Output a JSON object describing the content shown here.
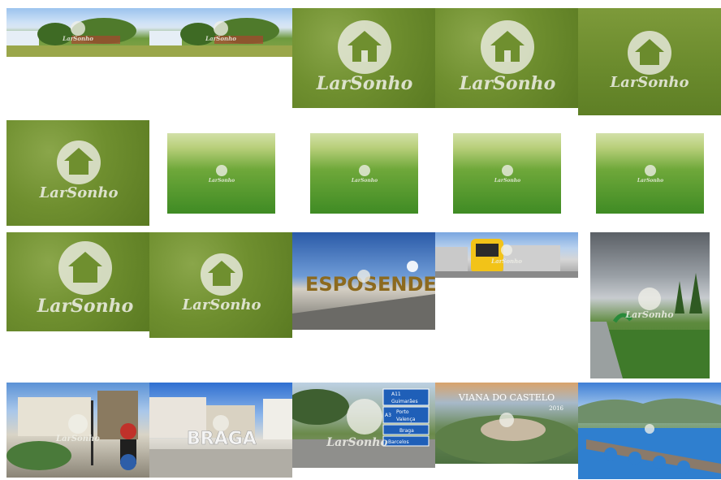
{
  "watermark": {
    "brand": "LarSonho"
  },
  "gallery": {
    "tiles": [
      {
        "scene": "coast",
        "sign": ""
      },
      {
        "scene": "coast",
        "sign": ""
      },
      {
        "scene": "grass",
        "sign": ""
      },
      {
        "scene": "grass",
        "sign": ""
      },
      {
        "scene": "grass",
        "sign": ""
      },
      {
        "scene": "grass",
        "sign": ""
      },
      {
        "scene": "meadow",
        "sign": ""
      },
      {
        "scene": "meadow",
        "sign": ""
      },
      {
        "scene": "meadow",
        "sign": ""
      },
      {
        "scene": "meadow",
        "sign": ""
      },
      {
        "scene": "grass",
        "sign": ""
      },
      {
        "scene": "grass",
        "sign": ""
      },
      {
        "scene": "esposende",
        "sign": "ESPOSENDE"
      },
      {
        "scene": "train",
        "sign": ""
      },
      {
        "scene": "park",
        "sign": ""
      },
      {
        "scene": "square",
        "sign": ""
      },
      {
        "scene": "braga",
        "sign": "BRAGA"
      },
      {
        "scene": "road",
        "sign": ""
      },
      {
        "scene": "viana",
        "sign": ""
      },
      {
        "scene": "bridge",
        "sign": ""
      }
    ],
    "road_signs": [
      "A11",
      "Guimarães",
      "A3",
      "Porto",
      "Valença",
      "Braga",
      "Barcelos"
    ],
    "viana_title": "VIANA DO CASTELO",
    "viana_year": "2016"
  }
}
